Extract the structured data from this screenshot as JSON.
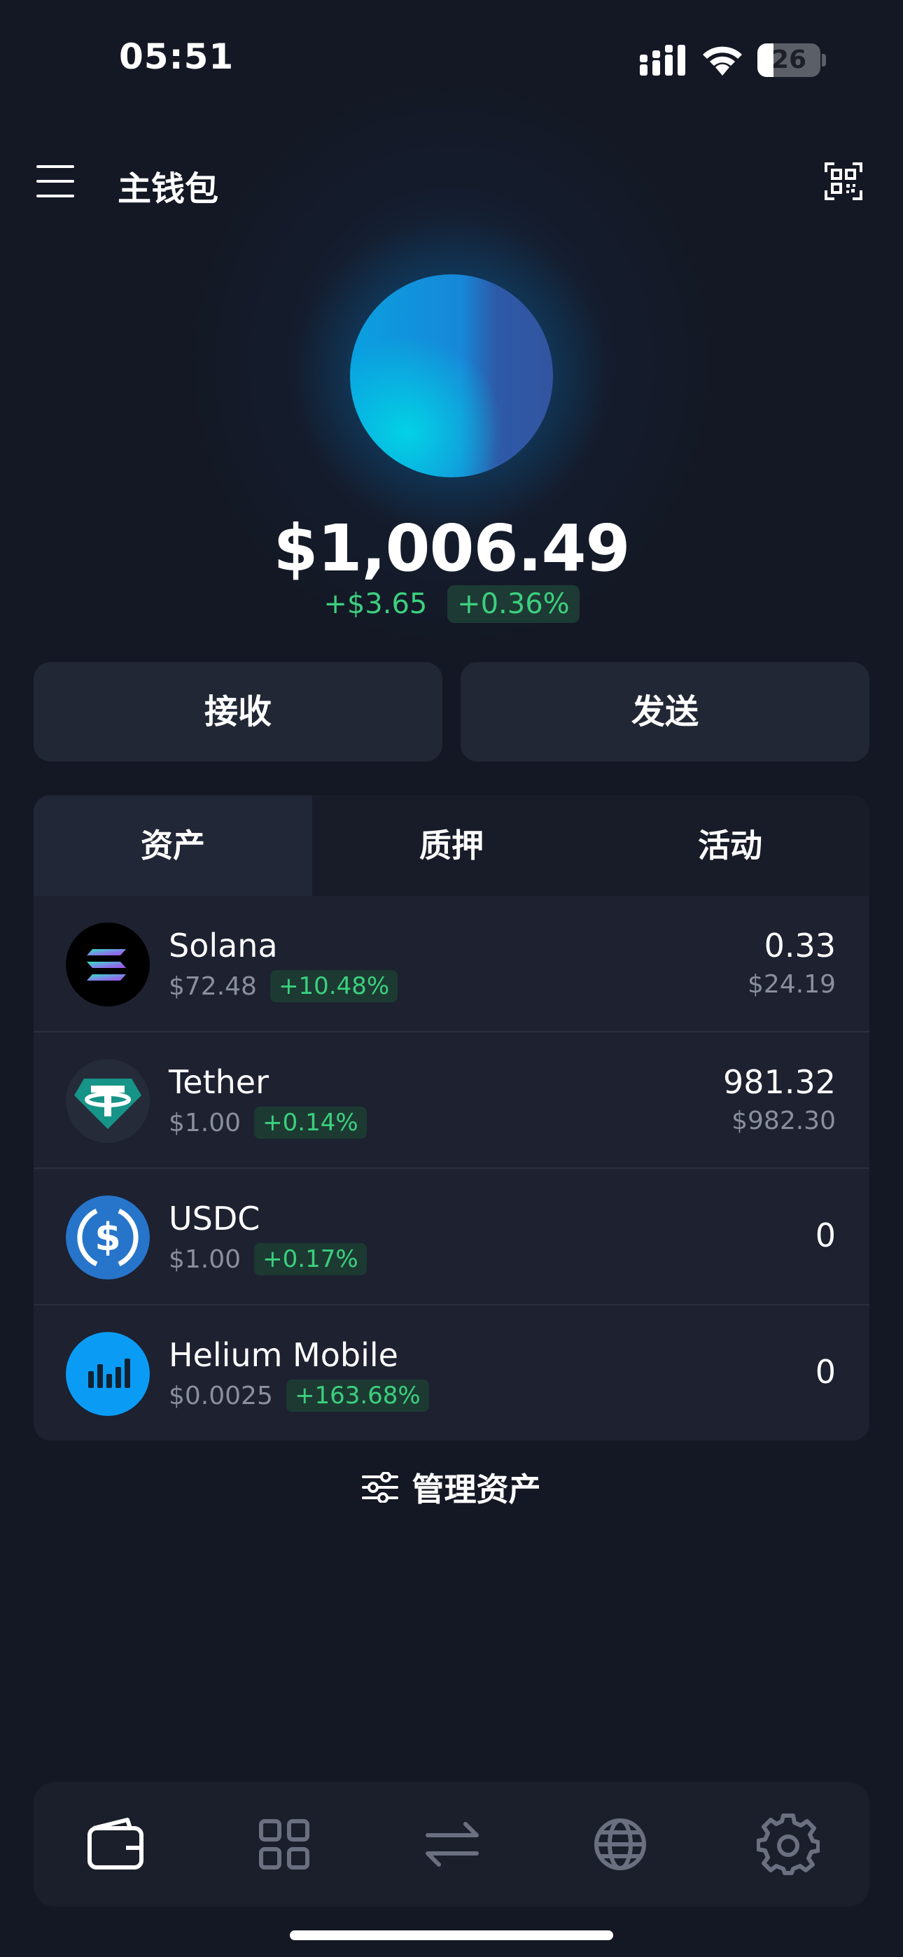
{
  "status_bar": {
    "time": "05:51",
    "battery": "26",
    "battery_level": 0.26
  },
  "header": {
    "title": "主钱包",
    "menu_icon": "hamburger-menu-icon",
    "qr_icon": "qr-scan-icon"
  },
  "balance": {
    "total": "$1,006.49",
    "change_abs": "+$3.65",
    "change_pct": "+0.36%"
  },
  "actions": {
    "receive": "接收",
    "send": "发送"
  },
  "tabs": [
    {
      "label": "资产",
      "active": true
    },
    {
      "label": "质押",
      "active": false
    },
    {
      "label": "活动",
      "active": false
    }
  ],
  "assets": [
    {
      "name": "Solana",
      "price": "$72.48",
      "change": "+10.48%",
      "amount": "0.33",
      "value": "$24.19",
      "icon": "solana-icon"
    },
    {
      "name": "Tether",
      "price": "$1.00",
      "change": "+0.14%",
      "amount": "981.32",
      "value": "$982.30",
      "icon": "tether-icon"
    },
    {
      "name": "USDC",
      "price": "$1.00",
      "change": "+0.17%",
      "amount": "0",
      "value": "",
      "icon": "usdc-icon"
    },
    {
      "name": "Helium Mobile",
      "price": "$0.0025",
      "change": "+163.68%",
      "amount": "0",
      "value": "",
      "icon": "helium-mobile-icon"
    }
  ],
  "manage": {
    "label": "管理资产",
    "icon": "sliders-icon"
  },
  "bottom_nav": [
    {
      "icon": "wallet-icon",
      "active": true
    },
    {
      "icon": "apps-grid-icon",
      "active": false
    },
    {
      "icon": "swap-icon",
      "active": false
    },
    {
      "icon": "globe-icon",
      "active": false
    },
    {
      "icon": "gear-icon",
      "active": false
    }
  ],
  "colors": {
    "background": "#141824",
    "card": "#1d2130",
    "positive": "#3ccf7e",
    "muted": "#8a8f9c",
    "inactive_nav": "#6b7080"
  }
}
